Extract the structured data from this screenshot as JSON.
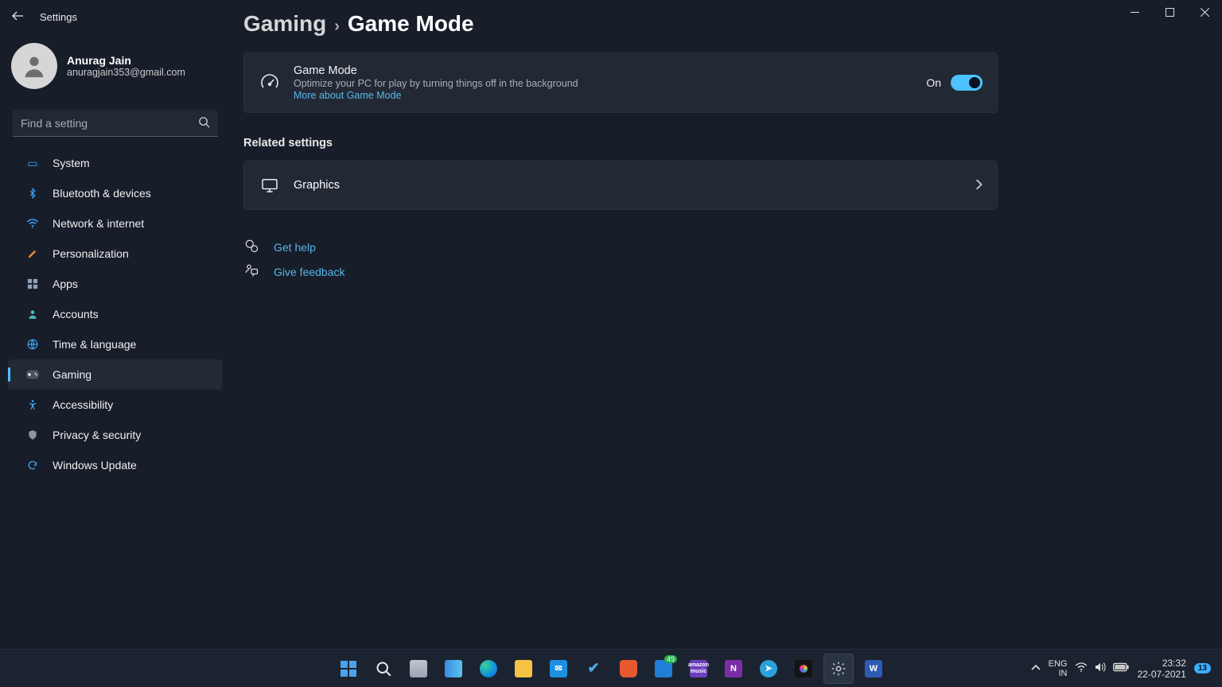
{
  "window": {
    "app_title": "Settings"
  },
  "user": {
    "name": "Anurag Jain",
    "email": "anuragjain353@gmail.com"
  },
  "search": {
    "placeholder": "Find a setting"
  },
  "sidebar": {
    "items": [
      {
        "label": "System"
      },
      {
        "label": "Bluetooth & devices"
      },
      {
        "label": "Network & internet"
      },
      {
        "label": "Personalization"
      },
      {
        "label": "Apps"
      },
      {
        "label": "Accounts"
      },
      {
        "label": "Time & language"
      },
      {
        "label": "Gaming"
      },
      {
        "label": "Accessibility"
      },
      {
        "label": "Privacy & security"
      },
      {
        "label": "Windows Update"
      }
    ],
    "active_index": 7
  },
  "breadcrumb": {
    "parent": "Gaming",
    "separator": "›",
    "current": "Game Mode"
  },
  "game_mode_card": {
    "title": "Game Mode",
    "description": "Optimize your PC for play by turning things off in the background",
    "more_link": "More about Game Mode",
    "state_label": "On",
    "state_on": true
  },
  "related": {
    "header": "Related settings",
    "items": [
      {
        "label": "Graphics"
      }
    ]
  },
  "help_links": {
    "help": "Get help",
    "feedback": "Give feedback"
  },
  "taskbar": {
    "apps_badge_49": "49",
    "lang_top": "ENG",
    "lang_bottom": "IN",
    "time": "23:32",
    "date": "22-07-2021",
    "tray_count": "13"
  }
}
